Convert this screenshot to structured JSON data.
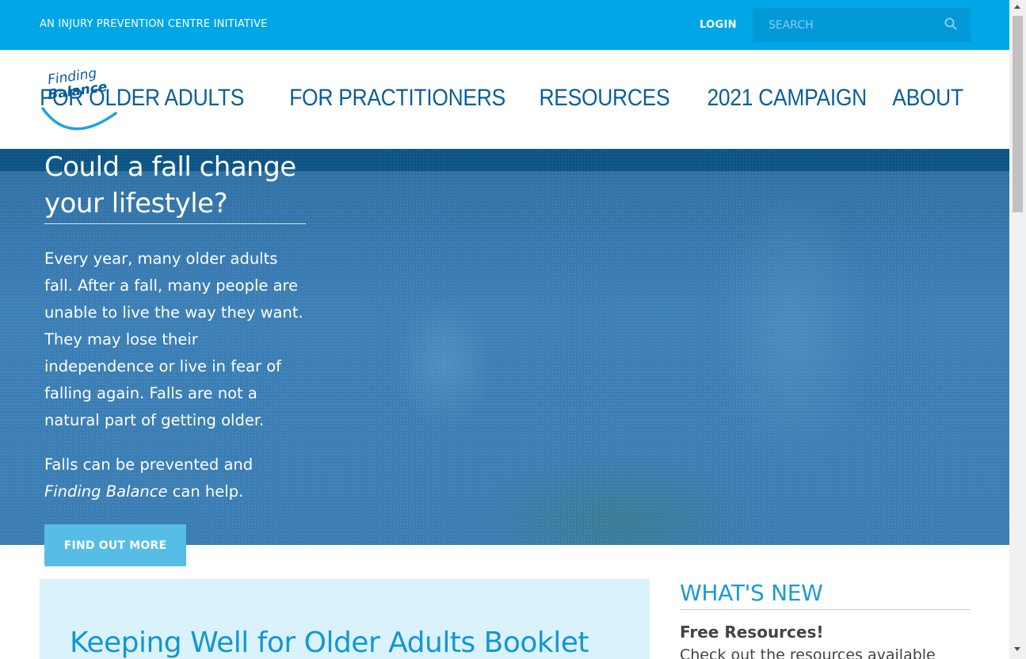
{
  "topbar": {
    "tagline": "AN INJURY PREVENTION CENTRE INITIATIVE",
    "login": "LOGIN",
    "search_placeholder": "SEARCH"
  },
  "logo": {
    "line1": "Finding",
    "line2": "Balance"
  },
  "nav": {
    "items": [
      {
        "label": "FOR OLDER ADULTS"
      },
      {
        "label": "FOR PRACTITIONERS"
      },
      {
        "label": "RESOURCES"
      },
      {
        "label": "2021 CAMPAIGN"
      },
      {
        "label": "ABOUT"
      }
    ]
  },
  "hero": {
    "title": "Could a fall change your lifestyle?",
    "paragraph1": "Every year, many older adults fall. After a fall, many people are unable to live the way they want. They may lose their independence or live in fear of falling again. Falls are not a natural part of getting older.",
    "paragraph2_prefix": "Falls can be prevented and ",
    "paragraph2_em": "Finding Balance",
    "paragraph2_suffix": " can help.",
    "button": "FIND OUT MORE"
  },
  "booklet": {
    "title": "Keeping Well for Older Adults Booklet"
  },
  "whats_new": {
    "heading": "WHAT'S NEW",
    "item_title": "Free Resources!",
    "item_text": "Check out the resources available"
  },
  "colors": {
    "topbar": "#00a6e6",
    "nav_text": "#0b5e9a",
    "button": "#57bde6",
    "booklet_bg": "#daf2fb",
    "heading_blue": "#1a9ad6"
  }
}
